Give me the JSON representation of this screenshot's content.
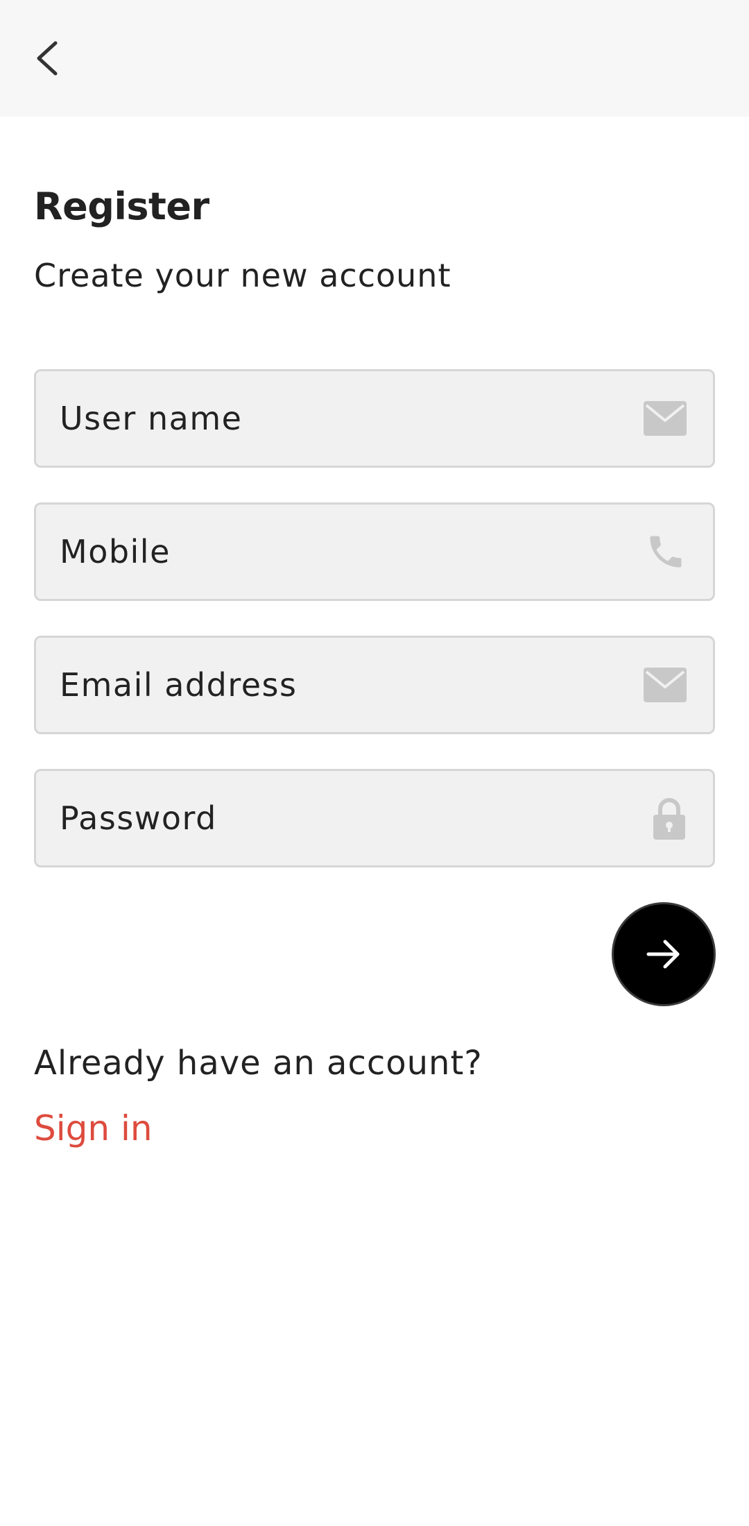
{
  "header": {
    "back_icon": "chevron-left-icon"
  },
  "page": {
    "title": "Register",
    "subtitle": "Create your new account"
  },
  "form": {
    "fields": [
      {
        "label": "User name",
        "icon": "mail-icon"
      },
      {
        "label": "Mobile",
        "icon": "phone-icon"
      },
      {
        "label": "Email address",
        "icon": "mail-icon"
      },
      {
        "label": "Password",
        "icon": "lock-icon"
      }
    ],
    "submit_icon": "arrow-right-icon"
  },
  "footer": {
    "prompt": "Already have an account?",
    "signin_label": "Sign in"
  },
  "colors": {
    "accent": "#dd4b3d",
    "field_bg": "#f1f1f1",
    "field_border": "#d6d6d6",
    "icon_gray": "#c8c8c8",
    "button_bg": "#000000"
  }
}
